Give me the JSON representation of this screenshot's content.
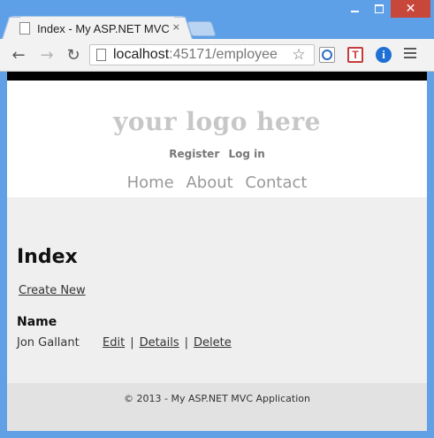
{
  "browser": {
    "tab_title": "Index - My ASP.NET MVC",
    "tab_close": "×",
    "url_host": "localhost",
    "url_path": ":45171/employee",
    "window_buttons": {
      "minimize": "minimize-icon",
      "maximize": "maximize-icon",
      "close": "✕"
    },
    "nav": {
      "back": "←",
      "forward": "→",
      "reload": "↻"
    },
    "star": "☆",
    "extensions": [
      "ie-tab-icon",
      "T",
      "i"
    ],
    "menu_icon": "hamburger-menu-icon",
    "accent_color": "#5ea0e8",
    "close_color": "#c7483b"
  },
  "site": {
    "logo": "your logo here",
    "login_links": [
      "Register",
      "Log in"
    ],
    "menu": [
      "Home",
      "About",
      "Contact"
    ]
  },
  "page": {
    "title": "Index",
    "create_link": "Create New",
    "table": {
      "columns": [
        "Name"
      ],
      "rows": [
        {
          "name": "Jon Gallant",
          "actions": [
            "Edit",
            "Details",
            "Delete"
          ]
        }
      ],
      "separator": "|"
    }
  },
  "footer": {
    "text": "© 2013 - My ASP.NET MVC Application"
  }
}
